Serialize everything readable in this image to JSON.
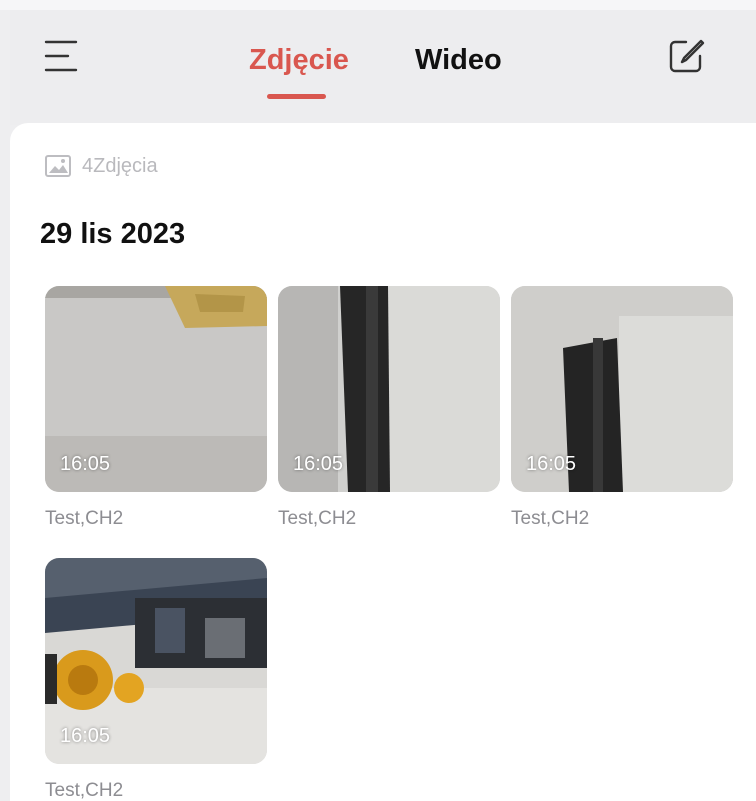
{
  "colors": {
    "accent": "#d9574f",
    "header_bg": "#ededef",
    "muted": "#b9b9bd"
  },
  "header": {
    "menu_icon": "hamburger-menu-icon",
    "tabs": [
      {
        "label": "Zdjęcie",
        "active": true
      },
      {
        "label": "Wideo",
        "active": false
      }
    ],
    "edit_icon": "edit-icon"
  },
  "summary": {
    "icon": "image-icon",
    "count_text": "4Zdjęcia"
  },
  "groups": [
    {
      "date": "29 lis 2023",
      "items": [
        {
          "time": "16:05",
          "caption": "Test,CH2"
        },
        {
          "time": "16:05",
          "caption": "Test,CH2"
        },
        {
          "time": "16:05",
          "caption": "Test,CH2"
        },
        {
          "time": "16:05",
          "caption": "Test,CH2"
        }
      ]
    }
  ]
}
